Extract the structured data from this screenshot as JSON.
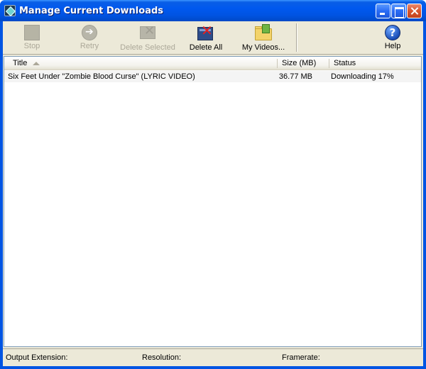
{
  "window": {
    "title": "Manage Current Downloads"
  },
  "toolbar": {
    "stop_label": "Stop",
    "retry_label": "Retry",
    "delete_selected_label": "Delete Selected",
    "delete_all_label": "Delete All",
    "my_videos_label": "My Videos...",
    "help_label": "Help"
  },
  "table": {
    "columns": [
      "Title",
      "Size (MB)",
      "Status"
    ],
    "rows": [
      {
        "title": "Six Feet Under \"Zombie Blood Curse\" (LYRIC VIDEO)",
        "size": "36.77 MB",
        "status": "Downloading 17%"
      }
    ]
  },
  "status_bar": {
    "output_extension_label": "Output Extension:",
    "resolution_label": "Resolution:",
    "framerate_label": "Framerate:"
  },
  "icons": {
    "app": "app-diamond-icon",
    "stop": "stop-square-icon",
    "retry": "retry-arrow-icon",
    "delete_selected": "film-delete-icon",
    "delete_all": "film-delete-red-icon",
    "my_videos": "folder-video-icon",
    "help": "help-question-icon"
  },
  "colors": {
    "titlebar": "#0054e3",
    "face": "#ece9d8",
    "disabled_text": "#aca899"
  }
}
